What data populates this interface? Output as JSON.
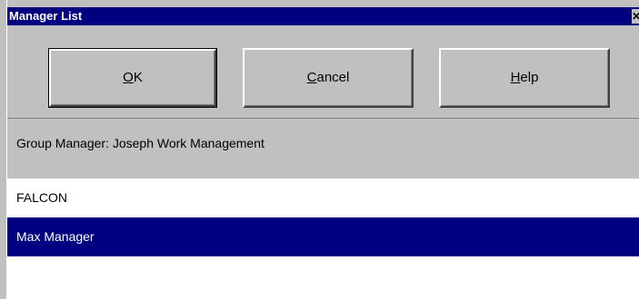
{
  "window": {
    "title": "Manager List",
    "close_glyph": "✕"
  },
  "toolbar": {
    "ok": {
      "mnemonic": "O",
      "rest": "K"
    },
    "cancel": {
      "mnemonic": "C",
      "rest": "ancel"
    },
    "help": {
      "mnemonic": "H",
      "rest": "elp"
    }
  },
  "group_manager_label": "Group Manager: Joseph Work Management",
  "list": {
    "items": [
      {
        "label": "FALCON",
        "selected": false
      },
      {
        "label": "Max Manager",
        "selected": true
      }
    ]
  },
  "colors": {
    "titlebar": "#000080",
    "selection": "#000080",
    "face": "#c0c0c0"
  }
}
